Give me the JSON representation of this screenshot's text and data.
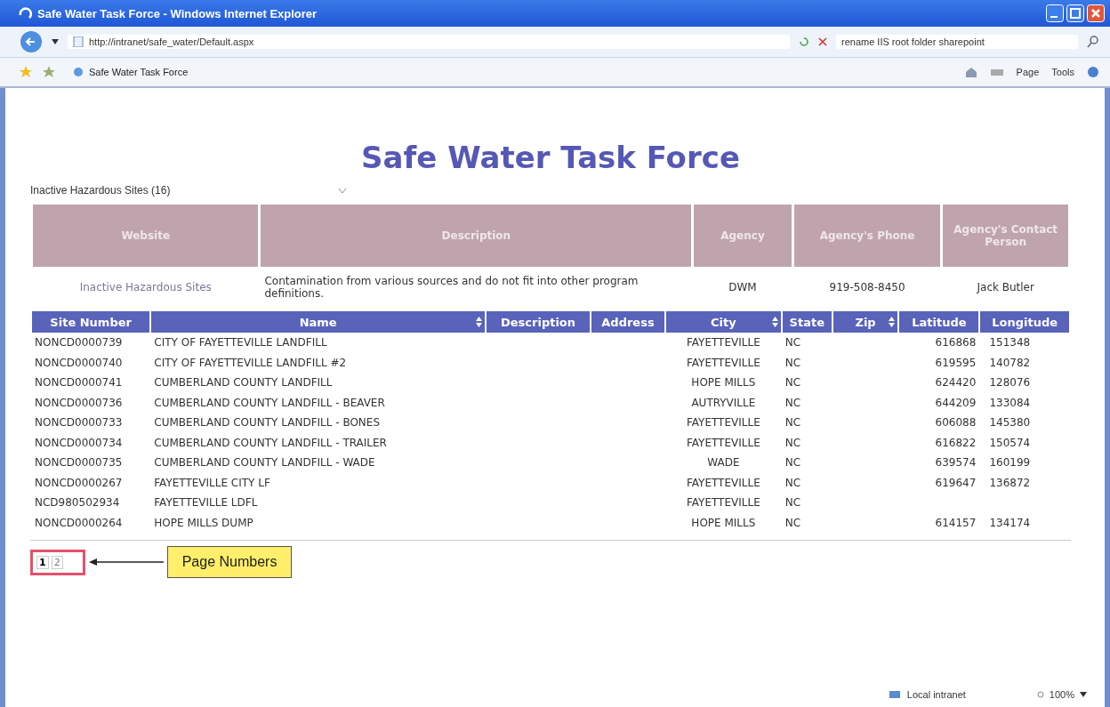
{
  "window": {
    "title": "Safe Water Task Force - Windows Internet Explorer"
  },
  "address_bar": {
    "url": "http://intranet/safe_water/Default.aspx"
  },
  "search_box": {
    "value": "rename IIS root folder sharepoint"
  },
  "favorites_tab": {
    "label": "Safe Water Task Force"
  },
  "command_bar": [
    {
      "label": "Page"
    },
    {
      "label": "Tools"
    }
  ],
  "page": {
    "heading": "Safe Water Task Force",
    "dropdown": {
      "value": "Inactive Hazardous Sites (16)"
    }
  },
  "info_table": {
    "columns": [
      "Website",
      "Description",
      "Agency",
      "Agency's Phone",
      "Agency's Contact Person"
    ],
    "rows": [
      [
        "Inactive Hazardous Sites",
        "Contamination from various sources and do not fit into other program definitions.",
        "DWM",
        "919-508-8450",
        "Jack Butler"
      ]
    ]
  },
  "sites_table": {
    "columns": [
      {
        "label": "Site Number",
        "sortable": false
      },
      {
        "label": "Name",
        "sortable": true
      },
      {
        "label": "Description",
        "sortable": false
      },
      {
        "label": "Address",
        "sortable": false
      },
      {
        "label": "City",
        "sortable": true
      },
      {
        "label": "State",
        "sortable": false
      },
      {
        "label": "Zip",
        "sortable": true
      },
      {
        "label": "Latitude",
        "sortable": false
      },
      {
        "label": "Longitude",
        "sortable": false
      }
    ],
    "rows": [
      [
        "NONCD0000739",
        "CITY OF FAYETTEVILLE LANDFILL",
        "",
        "",
        "FAYETTEVILLE",
        "NC",
        "",
        "616868",
        "151348"
      ],
      [
        "NONCD0000740",
        "CITY OF FAYETTEVILLE LANDFILL #2",
        "",
        "",
        "FAYETTEVILLE",
        "NC",
        "",
        "619595",
        "140782"
      ],
      [
        "NONCD0000741",
        "CUMBERLAND COUNTY LANDFILL",
        "",
        "",
        "HOPE MILLS",
        "NC",
        "",
        "624420",
        "128076"
      ],
      [
        "NONCD0000736",
        "CUMBERLAND COUNTY LANDFILL - BEAVER",
        "",
        "",
        "AUTRYVILLE",
        "NC",
        "",
        "644209",
        "133084"
      ],
      [
        "NONCD0000733",
        "CUMBERLAND COUNTY LANDFILL - BONES",
        "",
        "",
        "FAYETTEVILLE",
        "NC",
        "",
        "606088",
        "145380"
      ],
      [
        "NONCD0000734",
        "CUMBERLAND COUNTY LANDFILL - TRAILER",
        "",
        "",
        "FAYETTEVILLE",
        "NC",
        "",
        "616822",
        "150574"
      ],
      [
        "NONCD0000735",
        "CUMBERLAND COUNTY LANDFILL - WADE",
        "",
        "",
        "WADE",
        "NC",
        "",
        "639574",
        "160199"
      ],
      [
        "NONCD0000267",
        "FAYETTEVILLE CITY LF",
        "",
        "",
        "FAYETTEVILLE",
        "NC",
        "",
        "619647",
        "136872"
      ],
      [
        "NCD980502934",
        "FAYETTEVILLE LDFL",
        "",
        "",
        "FAYETTEVILLE",
        "NC",
        "",
        "",
        ""
      ],
      [
        "NONCD0000264",
        "HOPE MILLS DUMP",
        "",
        "",
        "HOPE MILLS",
        "NC",
        "",
        "614157",
        "134174"
      ]
    ]
  },
  "pager": {
    "pages": [
      {
        "label": "1",
        "selected": true
      },
      {
        "label": "2",
        "selected": false
      }
    ]
  },
  "callout": {
    "text": "Page Numbers"
  },
  "status_bar": {
    "zone": "Local intranet",
    "zoom": "100%"
  }
}
